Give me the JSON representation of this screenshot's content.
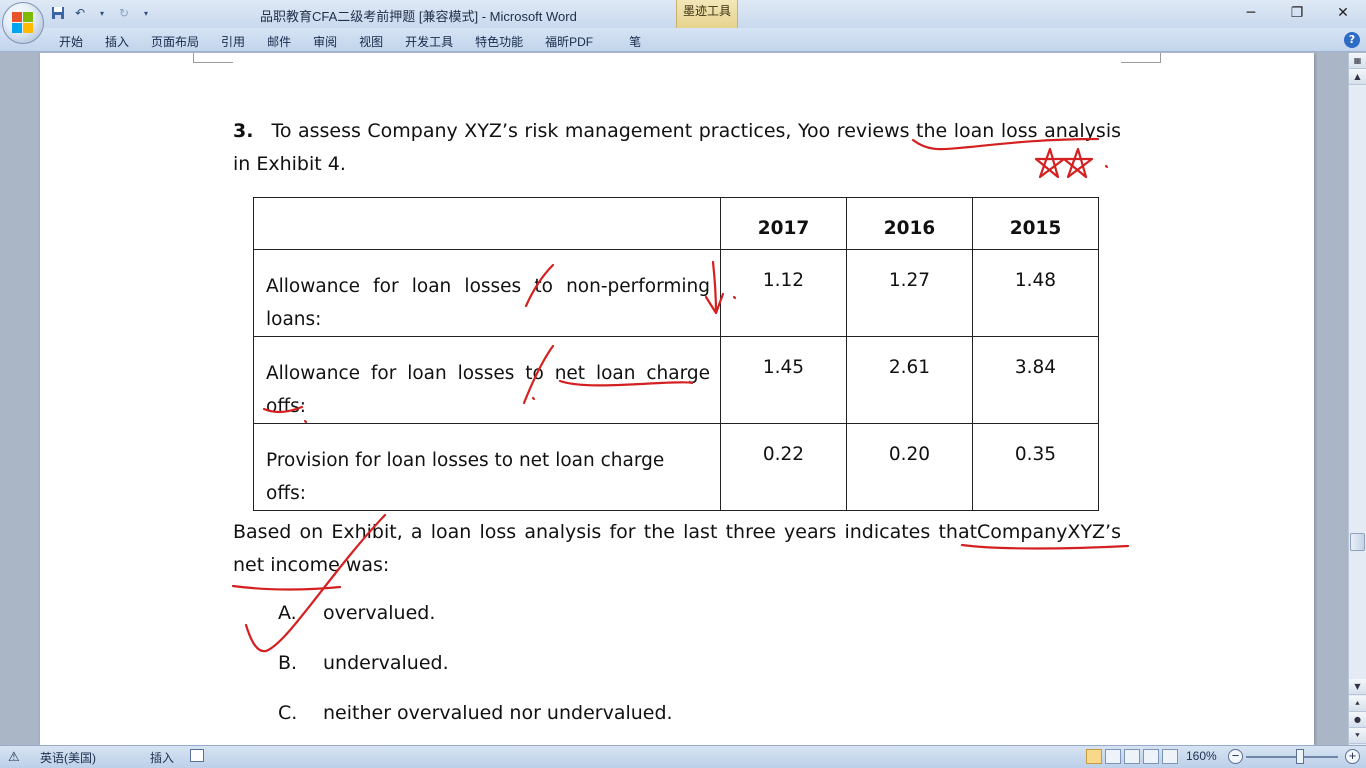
{
  "window": {
    "title": "品职教育CFA二级考前押题 [兼容模式] - Microsoft Word",
    "context_tab": "墨迹工具",
    "minimize": "─",
    "restore": "❐",
    "close": "✕"
  },
  "ribbon": {
    "tabs": [
      "开始",
      "插入",
      "页面布局",
      "引用",
      "邮件",
      "审阅",
      "视图",
      "开发工具",
      "特色功能",
      "福昕PDF",
      "笔"
    ],
    "help": "?"
  },
  "document": {
    "question_number": "3.",
    "question_text": "To assess Company XYZ’s risk management practices, Yoo reviews the loan loss analysis in Exhibit 4.",
    "table": {
      "years": [
        "2017",
        "2016",
        "2015"
      ],
      "rows": [
        {
          "label": "Allowance for loan losses to non-performing loans:",
          "values": [
            "1.12",
            "1.27",
            "1.48"
          ]
        },
        {
          "label": "Allowance for loan losses to net loan charge offs:",
          "values": [
            "1.45",
            "2.61",
            "3.84"
          ]
        },
        {
          "label": "Provision for loan losses to net loan charge offs:",
          "values": [
            "0.22",
            "0.20",
            "0.35"
          ]
        }
      ]
    },
    "follow_text": "Based on Exhibit, a loan loss analysis for the last three years indicates thatCompanyXYZ’s net income was:",
    "options": [
      {
        "letter": "A.",
        "text": "overvalued."
      },
      {
        "letter": "B.",
        "text": "undervalued."
      },
      {
        "letter": "C.",
        "text": "neither overvalued nor undervalued."
      }
    ]
  },
  "statusbar": {
    "language": "英语(美国)",
    "insert_mode": "插入",
    "zoom": "160%",
    "zoom_minus": "−",
    "zoom_plus": "+"
  },
  "colors": {
    "ink": "#d42020",
    "page": "#ffffff",
    "workspace": "#aab6c6"
  }
}
